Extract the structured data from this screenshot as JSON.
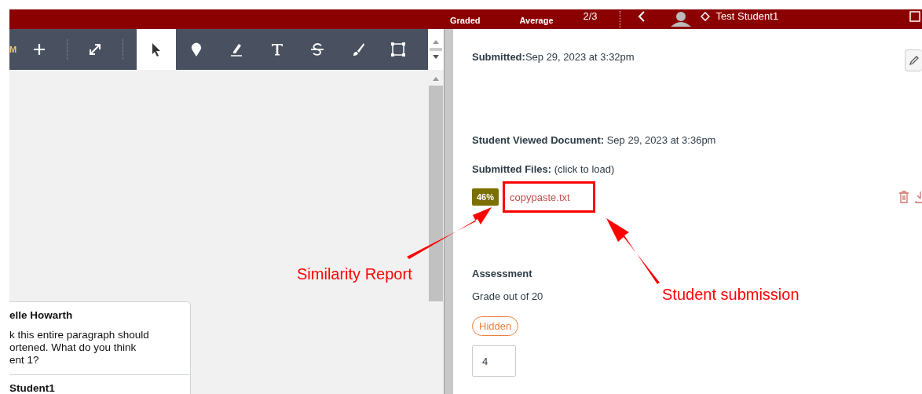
{
  "header": {
    "stats": [
      "Graded",
      "Average"
    ],
    "counter": "2/3",
    "student": "Test Student1"
  },
  "toolbar": {
    "label": "M",
    "tools": [
      {
        "kind": "plus",
        "selected": false
      },
      {
        "kind": "expand",
        "selected": false
      },
      {
        "kind": "cursor",
        "selected": true
      },
      {
        "kind": "pin",
        "selected": false
      },
      {
        "kind": "highlight",
        "selected": false
      },
      {
        "kind": "text",
        "selected": false
      },
      {
        "kind": "strike",
        "selected": false
      },
      {
        "kind": "brush",
        "selected": false
      },
      {
        "kind": "area",
        "selected": false
      }
    ]
  },
  "comments": [
    {
      "author": "elle Howarth",
      "lines": [
        "k this entire paragraph should",
        "ortened. What do you think",
        "ent 1?"
      ]
    },
    {
      "author": "Student1"
    }
  ],
  "submission": {
    "submitted": "**Submitted:**Sep 29, 2023 at 3:32pm",
    "viewed": "**Student Viewed Document:** Sep 29, 2023 at 3:36pm",
    "files_label": "**Submitted Files:** (click to load)",
    "files": [
      {
        "score": "46%",
        "name": "copypaste.txt"
      }
    ]
  },
  "assessment": {
    "title": "Assessment",
    "grade_label": "Grade out of 20",
    "status": "Hidden",
    "grade": "4"
  },
  "annotations": [
    {
      "text": "Similarity Report"
    },
    {
      "text": "Student submission"
    }
  ]
}
